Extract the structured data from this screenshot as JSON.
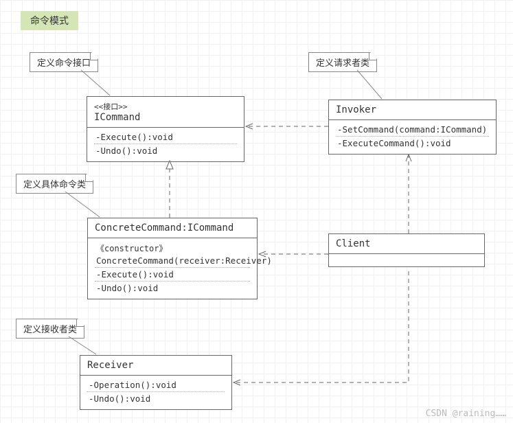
{
  "title": "命令模式",
  "notes": {
    "icommand": "定义命令接口",
    "invoker": "定义请求者类",
    "concrete": "定义具体命令类",
    "receiver": "定义接收者类"
  },
  "classes": {
    "icommand": {
      "stereo": "<<接口>>",
      "name": "ICommand",
      "ops": [
        "-Execute():void",
        "-Undo():void"
      ]
    },
    "invoker": {
      "name": "Invoker",
      "ops": [
        "-SetCommand(command:ICommand)",
        "-ExecuteCommand():void"
      ]
    },
    "concrete": {
      "name": "ConcreteCommand:ICommand",
      "constructor_stereo": "《constructor》",
      "constructor_sig": "ConcreteCommand(receiver:Receiver)",
      "ops": [
        "-Execute():void",
        "-Undo():void"
      ]
    },
    "client": {
      "name": "Client"
    },
    "receiver": {
      "name": "Receiver",
      "ops": [
        "-Operation():void",
        "-Undo():void"
      ]
    }
  },
  "watermark": "CSDN @raining……"
}
